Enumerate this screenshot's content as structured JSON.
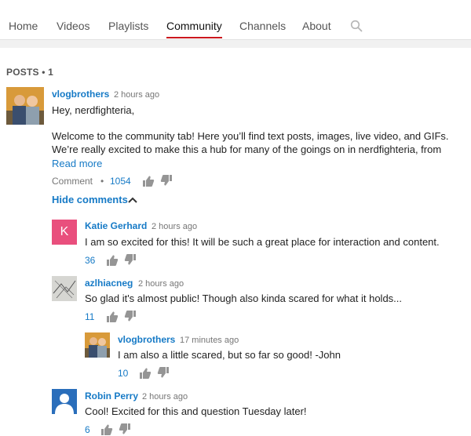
{
  "tabs": [
    {
      "label": "Home"
    },
    {
      "label": "Videos"
    },
    {
      "label": "Playlists"
    },
    {
      "label": "Community"
    },
    {
      "label": "Channels"
    },
    {
      "label": "About"
    }
  ],
  "posts_header": "POSTS • 1",
  "post": {
    "author": "vlogbrothers",
    "time": "2 hours ago",
    "line1": "Hey, nerdfighteria,",
    "line2": "Welcome to the community tab! Here you’ll find text posts, images, live video, and GIFs.",
    "line3": "We’re really excited to make this a hub for many of the goings on in nerdfighteria, from",
    "read_more": "Read more",
    "comment_label": "Comment",
    "separator": "•",
    "likes": "1054",
    "hide_comments": "Hide comments"
  },
  "comments": [
    {
      "author": "Katie Gerhard",
      "time": "2 hours ago",
      "text": "I am so excited for this! It will be such a great place for interaction and content.",
      "likes": "36",
      "initial": "K",
      "avatar_color": "#e94f7d"
    },
    {
      "author": "azlhiacneg",
      "time": "2 hours ago",
      "text": "So glad it's almost public! Though also kinda scared for what it holds...",
      "likes": "11"
    },
    {
      "author": "vlogbrothers",
      "time": "17 minutes ago",
      "text": "I am also a little scared, but so far so good! -John",
      "likes": "10"
    },
    {
      "author": "Robin Perry",
      "time": "2 hours ago",
      "text": "Cool! Excited for this and question Tuesday later!",
      "likes": "6"
    }
  ],
  "colors": {
    "accent": "#cc181e",
    "link": "#167ac6"
  }
}
